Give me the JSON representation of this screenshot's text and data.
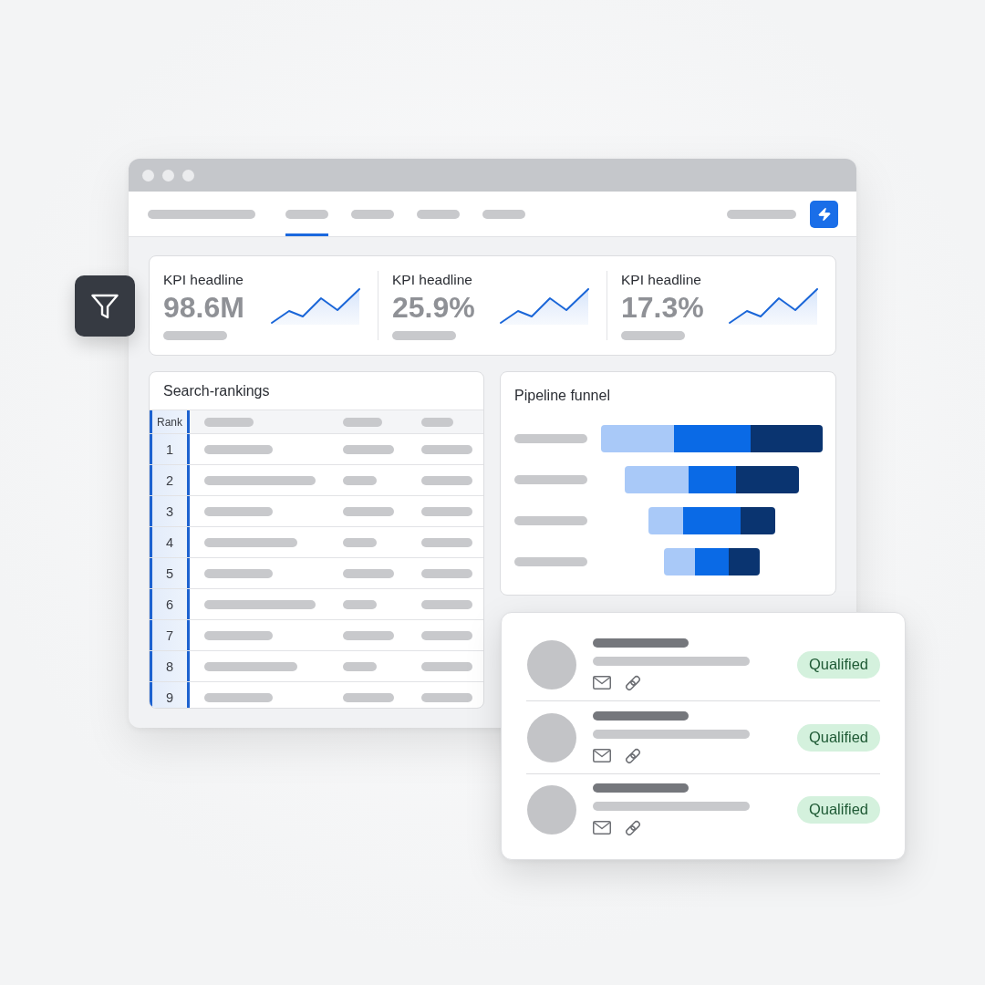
{
  "nav": {
    "tabs": [
      {
        "selected": true
      },
      {
        "selected": false
      },
      {
        "selected": false
      },
      {
        "selected": false
      }
    ]
  },
  "kpis": [
    {
      "label": "KPI headline",
      "value": "98.6M"
    },
    {
      "label": "KPI headline",
      "value": "25.9%"
    },
    {
      "label": "KPI headline",
      "value": "17.3%"
    }
  ],
  "search_rankings": {
    "title": "Search-rankings",
    "rank_header": "Rank",
    "rows": [
      {
        "rank": "1"
      },
      {
        "rank": "2"
      },
      {
        "rank": "3"
      },
      {
        "rank": "4"
      },
      {
        "rank": "5"
      },
      {
        "rank": "6"
      },
      {
        "rank": "7"
      },
      {
        "rank": "8"
      },
      {
        "rank": "9"
      }
    ]
  },
  "pipeline_funnel": {
    "title": "Pipeline funnel"
  },
  "leads": [
    {
      "status": "Qualified"
    },
    {
      "status": "Qualified"
    },
    {
      "status": "Qualified"
    }
  ]
}
